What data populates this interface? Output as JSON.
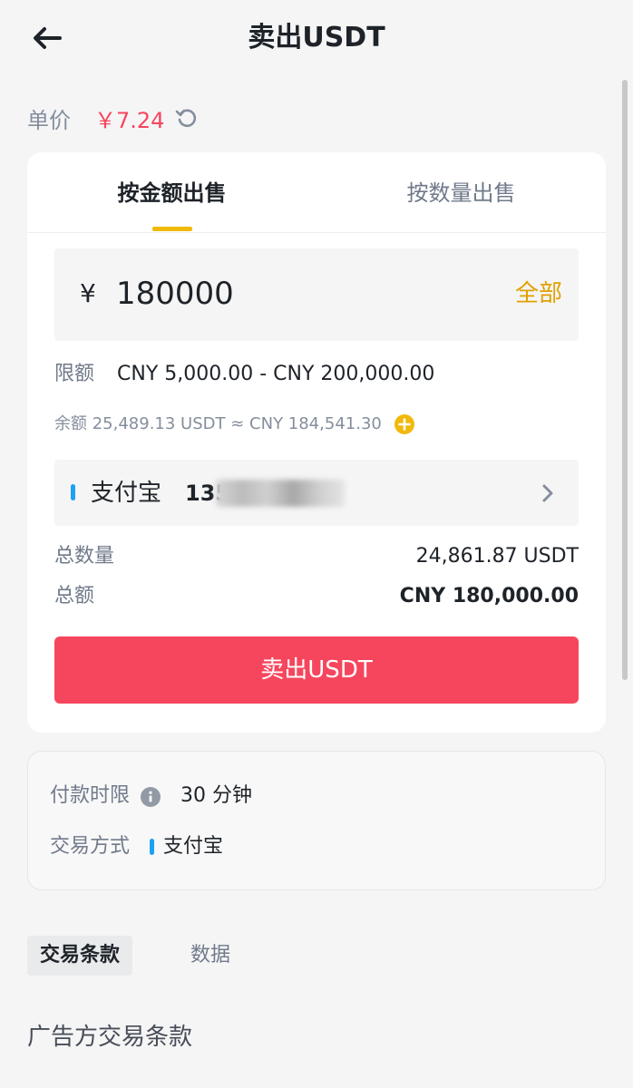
{
  "header": {
    "title": "卖出USDT"
  },
  "price": {
    "label": "单价",
    "value": "￥7.24"
  },
  "tabs": [
    {
      "label": "按金额出售",
      "active": true
    },
    {
      "label": "按数量出售",
      "active": false
    }
  ],
  "amount": {
    "currency_symbol": "¥",
    "value": "180000",
    "all_label": "全部"
  },
  "limit": {
    "label": "限额",
    "value": "CNY 5,000.00 - CNY 200,000.00"
  },
  "balance": {
    "text": "余额 25,489.13 USDT ≈ CNY 184,541.30"
  },
  "payment": {
    "method": "支付宝",
    "account_visible": "135"
  },
  "summary": {
    "total_qty_label": "总数量",
    "total_qty_value": "24,861.87 USDT",
    "total_amount_label": "总额",
    "total_amount_value": "CNY 180,000.00"
  },
  "sell_button": {
    "label": "卖出USDT"
  },
  "info": {
    "time_limit_label": "付款时限",
    "time_limit_value": "30 分钟",
    "trade_method_label": "交易方式",
    "trade_method_value": "支付宝"
  },
  "subtabs": {
    "terms": "交易条款",
    "data": "数据"
  },
  "terms_title": "广告方交易条款",
  "colors": {
    "accent_yellow": "#f0b90b",
    "sell_red": "#f6465d",
    "alipay_blue": "#1da1f2",
    "text_gray": "#707a8a"
  }
}
